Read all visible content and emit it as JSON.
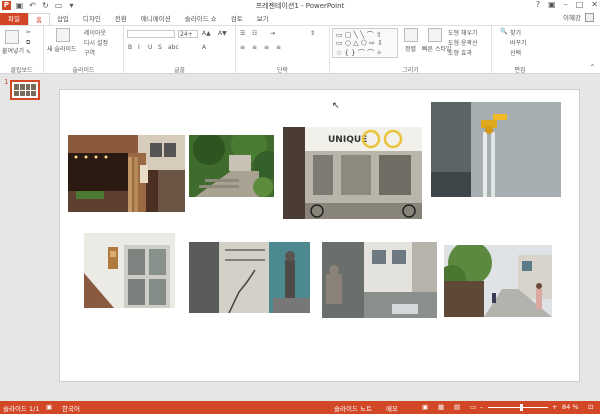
{
  "titlebar": {
    "app_icon": "P",
    "title": "프레젠테이션1 - PowerPoint"
  },
  "tabs": [
    "파일",
    "홈",
    "삽입",
    "디자인",
    "전환",
    "애니메이션",
    "슬라이드 쇼",
    "검토",
    "보기"
  ],
  "user": {
    "name": "이혜강"
  },
  "ribbon": {
    "clipboard": {
      "paste": "붙여넣기",
      "label": "클립보드"
    },
    "slides": {
      "new_slide": "새 슬라이드",
      "layout": "레이아웃",
      "reset": "다시 설정",
      "section": "구역",
      "label": "슬라이드"
    },
    "font": {
      "size": "24+",
      "label": "글꼴"
    },
    "paragraph": {
      "label": "단락"
    },
    "drawing": {
      "arrange": "정렬",
      "quick_styles": "빠른 스타일",
      "fill": "도형 채우기",
      "outline": "도형 윤곽선",
      "effects": "도형 효과",
      "label": "그리기"
    },
    "editing": {
      "find": "찾기",
      "replace": "바꾸기",
      "select": "선택",
      "label": "편집"
    }
  },
  "thumbnails": {
    "slide_number": "1"
  },
  "statusbar": {
    "slide_info": "슬라이드 1/1",
    "language": "한국어",
    "notes": "슬라이드 노트",
    "comments": "메모",
    "zoom": "84 %",
    "zoom_level": 0.84
  }
}
